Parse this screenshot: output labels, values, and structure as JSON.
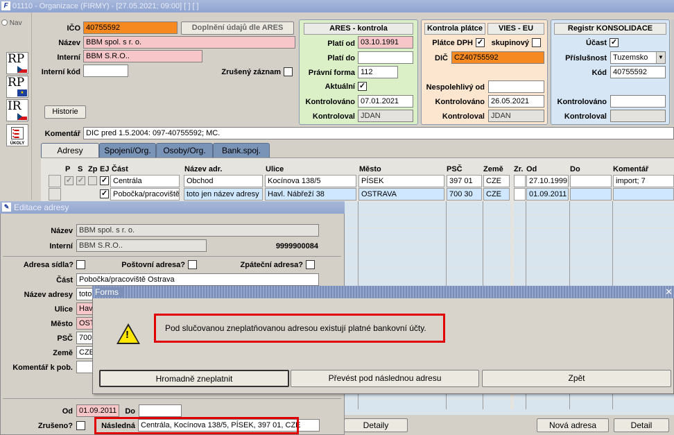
{
  "window": {
    "title": "01110 - Organizace (FIRMY) - [27.05.2021; 09:00]  [ ]  [ ]"
  },
  "sidebar": {
    "nav_label": "Nav",
    "rp_cz": "RP",
    "rp_eu": "RP",
    "ir": "IR",
    "ukoly": "ÚKOLY"
  },
  "org": {
    "ico_label": "IČO",
    "ico": "40755592",
    "nazev_label": "Název",
    "nazev": "BBM spol. s r. o.",
    "interni_label": "Interní",
    "interni": "BBM S.R.O..",
    "interni_kod_label": "Interní kód",
    "interni_kod": "",
    "zruseny_label": "Zrušený záznam",
    "doplneni_button": "Doplnění údajů dle ARES",
    "historie_button": "Historie",
    "komentar_label": "Komentář",
    "komentar": "DIC pred 1.5.2004: 097-40755592; MC."
  },
  "ares": {
    "title": "ARES - kontrola",
    "plati_od_label": "Platí od",
    "plati_od": "03.10.1991",
    "plati_do_label": "Platí do",
    "plati_do": "",
    "pravni_forma_label": "Právní forma",
    "pravni_forma": "112",
    "aktualni_label": "Aktuální",
    "kontrolovano_label": "Kontrolováno",
    "kontrolovano": "07.01.2021",
    "kontroloval_label": "Kontroloval",
    "kontroloval": "JDAN"
  },
  "platce": {
    "title": "Kontrola plátce",
    "vies_title": "VIES - EU",
    "platce_dph_label": "Plátce DPH",
    "skupinovy_label": "skupinový",
    "dic_label": "DIČ",
    "dic": "CZ40755592",
    "nespolehlivy_label": "Nespolehlivý od",
    "nespolehlivy": "",
    "kontrolovano_label": "Kontrolováno",
    "kontrolovano": "26.05.2021",
    "kontroloval_label": "Kontroloval",
    "kontroloval": "JDAN"
  },
  "konsolidace": {
    "title": "Registr KONSOLIDACE",
    "ucast_label": "Účast",
    "prislusnost_label": "Příslušnost",
    "prislusnost": "Tuzemsko",
    "kod_label": "Kód",
    "kod": "40755592",
    "kontrolovano_label": "Kontrolováno",
    "kontrolovano": "",
    "kontroloval_label": "Kontroloval",
    "kontroloval": ""
  },
  "tabs": [
    {
      "label": "Adresy"
    },
    {
      "label": "Spojení/Org."
    },
    {
      "label": "Osoby/Org."
    },
    {
      "label": "Bank.spoj."
    }
  ],
  "grid": {
    "headers": {
      "p": "P",
      "s": "S",
      "zp": "Zp",
      "ej": "EJ",
      "cast": "Část",
      "nazev_adr": "Název adr.",
      "ulice": "Ulice",
      "mesto": "Město",
      "psc": "PSČ",
      "zeme": "Země",
      "zr": "Zr.",
      "od": "Od",
      "do": "Do",
      "komentar": "Komentář"
    },
    "rows": [
      {
        "cast": "Centrála",
        "nazev_adr": "Obchod",
        "ulice": "Kocínova 138/5",
        "mesto": "PÍSEK",
        "psc": "397 01",
        "zeme": "CZE",
        "od": "27.10.1999",
        "do": "",
        "komentar": "import; 7"
      },
      {
        "cast": "Pobočka/pracoviště",
        "nazev_adr": "toto jen název adresy",
        "ulice": "Havl. Nábřeží 38",
        "mesto": "OSTRAVA",
        "psc": "700 30",
        "zeme": "CZE",
        "od": "01.09.2011",
        "do": "",
        "komentar": ""
      }
    ]
  },
  "edit": {
    "title": "Editace adresy",
    "nazev_label": "Název",
    "nazev": "BBM spol. s r. o.",
    "interni_label": "Interní",
    "interni": "BBM S.R.O..",
    "id": "9999900084",
    "adresa_sidla_label": "Adresa sídla?",
    "postovni_label": "Poštovní adresa?",
    "zpatecni_label": "Zpáteční adresa?",
    "cast_label": "Část",
    "cast": "Pobočka/pracoviště Ostrava",
    "nazev_adresy_label": "Název adresy",
    "nazev_adresy": "toto",
    "ulice_label": "Ulice",
    "ulice": "Hav",
    "mesto_label": "Město",
    "mesto": "OST",
    "psc_label": "PSČ",
    "psc": "700",
    "zeme_label": "Země",
    "zeme": "CZE",
    "komentar_label": "Komentář k pob.",
    "komentar": "",
    "od_label": "Od",
    "od": "01.09.2011",
    "do_label": "Do",
    "do": "",
    "zruseno_label": "Zrušeno?",
    "nasledna_label": "Následná",
    "nasledna": "Centrála, Kocínova 138/5, PÍSEK, 397 01, CZE"
  },
  "bottom_buttons": {
    "detaily": "Detaily",
    "nova_adresa": "Nová adresa",
    "detail": "Detail"
  },
  "dialog": {
    "title": "Forms",
    "message": "Pod slučovanou zneplatňovanou adresou existují platné bankovní účty.",
    "btn1": "Hromadně zneplatnit",
    "btn2": "Převést pod následnou adresu",
    "btn3": "Zpět"
  },
  "colors": {
    "orange": "#f6891f",
    "pink": "#f7c6c9",
    "ares_bg": "#dcf0c8",
    "platce_bg": "#fde6cf",
    "kons_bg": "#d6e6f4",
    "highlight": "#e00000"
  }
}
